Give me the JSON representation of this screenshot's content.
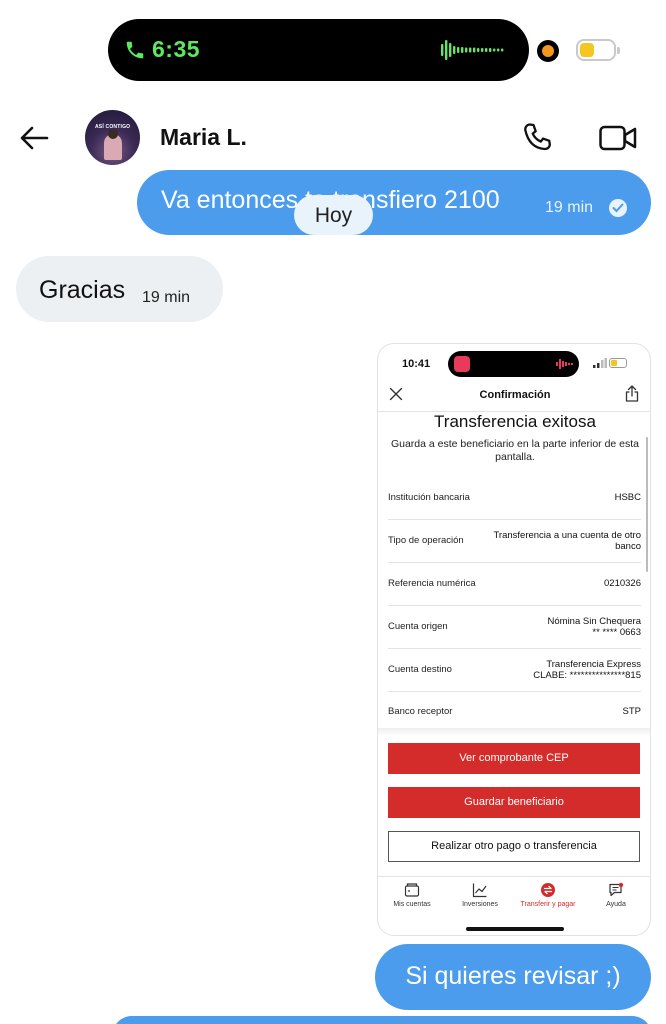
{
  "status_bar": {
    "time": "6:35"
  },
  "header": {
    "contact_name": "Maria L.",
    "avatar_text": "ASÍ CONTIGO"
  },
  "messages": {
    "m1": {
      "text": "Va entonces te transfiero 2100",
      "time": "19 min"
    },
    "day_separator": "Hoy",
    "m2": {
      "text": "Gracias",
      "time": "19 min"
    },
    "m3": {
      "text": "Si quieres revisar ;)"
    }
  },
  "shot": {
    "time": "10:41",
    "title": "Confirmación",
    "heading": "Transferencia exitosa",
    "subtitle": "Guarda a este beneficiario en la parte inferior de esta pantalla.",
    "rows": [
      {
        "label": "Institución bancaria",
        "value": "HSBC",
        "value2": ""
      },
      {
        "label": "Tipo de operación",
        "value": "Transferencia a una cuenta de otro",
        "value2": "banco"
      },
      {
        "label": "Referencia numérica",
        "value": "0210326",
        "value2": ""
      },
      {
        "label": "Cuenta origen",
        "value": "Nómina Sin Chequera",
        "value2": "** **** 0663"
      },
      {
        "label": "Cuenta destino",
        "value": "Transferencia Express",
        "value2": "CLABE: ***************815"
      },
      {
        "label": "Banco receptor",
        "value": "STP",
        "value2": ""
      }
    ],
    "buttons": {
      "cep": "Ver comprobante CEP",
      "save": "Guardar beneficiario",
      "other": "Realizar otro pago o transferencia"
    },
    "nav": [
      "Mis cuentas",
      "Inversiones",
      "Transferir y pagar",
      "Ayuda"
    ],
    "accent": "#d42c2a"
  },
  "colors": {
    "bubble_out": "#4b9cec",
    "bubble_in": "#ecf0f2",
    "call_green": "#5ee85e"
  }
}
